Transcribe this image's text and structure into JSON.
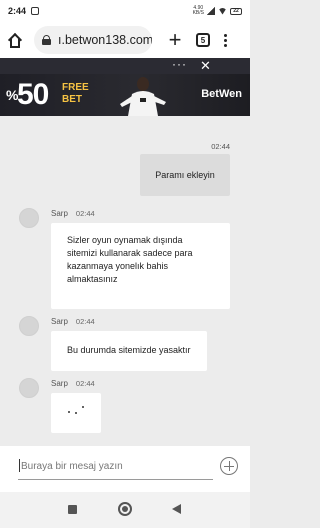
{
  "status_bar": {
    "time": "2:44",
    "speed": "4.90\nKB/S",
    "battery": "22"
  },
  "browser": {
    "url": "ı.betwon138.com",
    "tab_count": "5"
  },
  "banner": {
    "percent": "%",
    "big_number": "50",
    "line1": "FREE",
    "line2": "BET",
    "brand_a": "Bet",
    "brand_b": "Wen"
  },
  "chat": {
    "outgoing": {
      "time": "02:44",
      "text": "Paramı ekleyin"
    },
    "incoming": [
      {
        "sender": "Sarp",
        "time": "02:44",
        "text": "Sizler oyun oynamak dışında sitemizi kullanarak sadece para kazanmaya yonelık bahis almaktasınız"
      },
      {
        "sender": "Sarp",
        "time": "02:44",
        "text": "Bu durumda sitemizde yasaktır"
      },
      {
        "sender": "Sarp",
        "time": "02:44",
        "typing": true
      }
    ]
  },
  "composer": {
    "placeholder": "Buraya bir mesaj yazın"
  },
  "colors": {
    "banner_bg": "#23232a",
    "accent_yellow": "#f6c343",
    "chat_bg": "#ececec",
    "outgoing_bubble": "#dcdcdc"
  },
  "icons": [
    "home-icon",
    "lock-icon",
    "plus-icon",
    "tabs-icon",
    "menu-icon",
    "add-attachment-icon",
    "nav-recents-icon",
    "nav-home-icon",
    "nav-back-icon"
  ]
}
